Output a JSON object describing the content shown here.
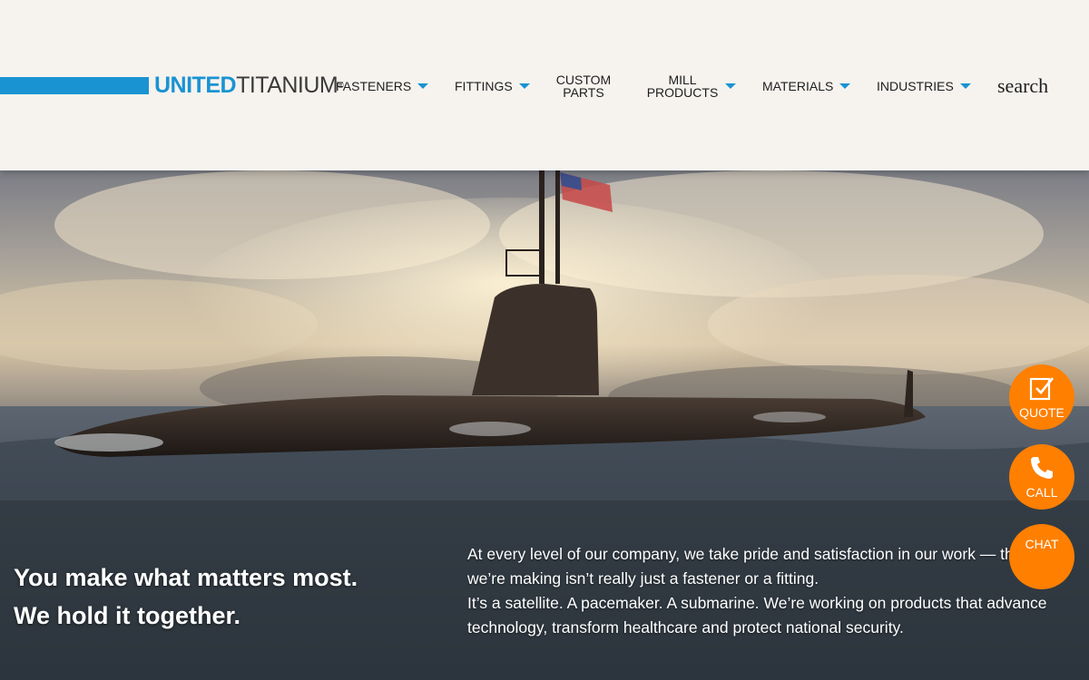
{
  "header": {
    "logo_united": "UNITED",
    "logo_titanium": "TITANIUM",
    "logo_reg": "®",
    "nav": [
      {
        "label": "FASTENERS"
      },
      {
        "label": "FITTINGS"
      },
      {
        "label": "CUSTOM PARTS"
      },
      {
        "label": "MILL PRODUCTS"
      },
      {
        "label": "MATERIALS"
      },
      {
        "label": "INDUSTRIES"
      }
    ],
    "search_label": "search"
  },
  "hero": {
    "headline_line1": "You make what matters most.",
    "headline_line2": "We hold it together.",
    "body_line1": "At every level of our company, we take pride and satisfaction in our work — that what we’re making isn’t really just a fastener or a fitting.",
    "body_line2": "It’s a satellite. A pacemaker. A submarine. We’re working on products that advance technology, transform healthcare and protect national security."
  },
  "actions": {
    "quote_label": "QUOTE",
    "call_label": "CALL",
    "chat_label": "CHAT"
  },
  "colors": {
    "brand_blue": "#1a93d2",
    "action_orange": "#ff7f00",
    "header_bg": "#f6f3ef"
  },
  "icons": [
    "quote-icon",
    "phone-icon",
    "caret-down-icon"
  ]
}
